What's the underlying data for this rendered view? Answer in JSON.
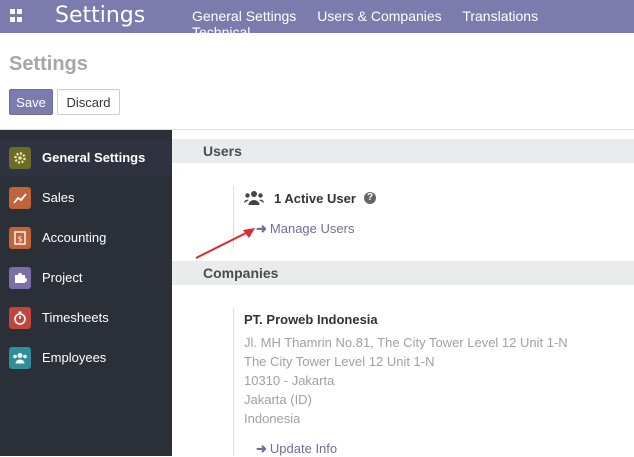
{
  "topbar": {
    "app_title": "Settings",
    "menu": [
      "General Settings",
      "Users & Companies",
      "Translations",
      "Technical"
    ]
  },
  "control": {
    "page_title": "Settings",
    "save_label": "Save",
    "discard_label": "Discard"
  },
  "sidebar": {
    "items": [
      {
        "label": "General Settings",
        "icon": "gear-icon",
        "color": "#6b6b2a",
        "active": true
      },
      {
        "label": "Sales",
        "icon": "chart-icon",
        "color": "#c0643c"
      },
      {
        "label": "Accounting",
        "icon": "invoice-icon",
        "color": "#c0643c"
      },
      {
        "label": "Project",
        "icon": "puzzle-icon",
        "color": "#7c6fa8"
      },
      {
        "label": "Timesheets",
        "icon": "stopwatch-icon",
        "color": "#c0463c"
      },
      {
        "label": "Employees",
        "icon": "people-icon",
        "color": "#2e8f9a"
      }
    ]
  },
  "users_section": {
    "title": "Users",
    "active_users": "1 Active User",
    "manage_link": "Manage Users"
  },
  "companies_section": {
    "title": "Companies",
    "company_name": "PT. Proweb Indonesia",
    "address_lines": [
      "Jl. MH Thamrin No.81, The City Tower Level 12 Unit  1-N",
      "The City Tower Level 12 Unit  1-N",
      "10310 - Jakarta",
      "Jakarta (ID)",
      "Indonesia"
    ],
    "update_link": "Update Info"
  },
  "colors": {
    "brand": "#7c7bad",
    "sidebar_bg": "#2b2f38",
    "annotation_arrow": "#e0282e"
  }
}
